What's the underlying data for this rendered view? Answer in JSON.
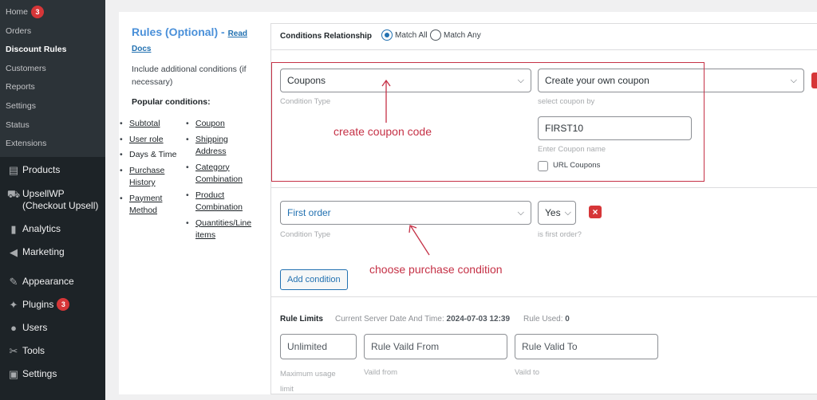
{
  "sidebar": {
    "submenu": [
      {
        "label": "Home",
        "badge": "3"
      },
      {
        "label": "Orders"
      },
      {
        "label": "Discount Rules"
      },
      {
        "label": "Customers"
      },
      {
        "label": "Reports"
      },
      {
        "label": "Settings"
      },
      {
        "label": "Status"
      },
      {
        "label": "Extensions"
      }
    ],
    "menu": [
      {
        "label": "Products",
        "icon": "archive-icon"
      },
      {
        "label": "UpsellWP (Checkout Upsell)",
        "icon": "cart-icon"
      },
      {
        "label": "Analytics",
        "icon": "bar-chart-icon"
      },
      {
        "label": "Marketing",
        "icon": "megaphone-icon"
      },
      {
        "label": "Appearance",
        "icon": "paintbrush-icon"
      },
      {
        "label": "Plugins",
        "icon": "plugin-icon",
        "badge": "3"
      },
      {
        "label": "Users",
        "icon": "user-icon"
      },
      {
        "label": "Tools",
        "icon": "wrench-icon"
      },
      {
        "label": "Settings",
        "icon": "settings-icon"
      }
    ]
  },
  "rules_panel": {
    "title": "Rules (Optional) -",
    "docs_link": "Read Docs",
    "description": "Include additional conditions (if necessary)",
    "popular_heading": "Popular conditions:",
    "col1": [
      "Subtotal",
      "User role",
      "Days & Time",
      "Purchase History",
      "Payment Method"
    ],
    "col2": [
      "Coupon",
      "Shipping Address",
      "Category Combination",
      "Product Combination",
      "Quantities/Line items"
    ]
  },
  "conditions": {
    "relationship_label": "Conditions Relationship",
    "match_all": "Match All",
    "match_any": "Match Any",
    "row1": {
      "type_value": "Coupons",
      "type_hint": "Condition Type",
      "coupon_select": "Create your own coupon",
      "coupon_hint": "select coupon by",
      "coupon_name": "FIRST10",
      "coupon_name_hint": "Enter Coupon name",
      "url_coupons": "URL Coupons"
    },
    "row2": {
      "type_value": "First order",
      "type_hint": "Condition Type",
      "yes_value": "Yes",
      "yes_hint": "is first order?"
    },
    "add_condition": "Add condition"
  },
  "annotations": {
    "coupon": "create coupon code",
    "purchase": "choose purchase condition"
  },
  "rule_limits": {
    "label": "Rule Limits",
    "server_time_label": "Current Server Date And Time:",
    "server_time_value": "2024-07-03 12:39",
    "rule_used_label": "Rule Used:",
    "rule_used_value": "0",
    "unlimited_placeholder": "Unlimited",
    "valid_from_placeholder": "Rule Vaild From",
    "valid_to_placeholder": "Rule Valid To",
    "max_usage_hint": "Maximum usage limit",
    "valid_from_hint": "Vaild from",
    "valid_to_hint": "Vaild to"
  }
}
